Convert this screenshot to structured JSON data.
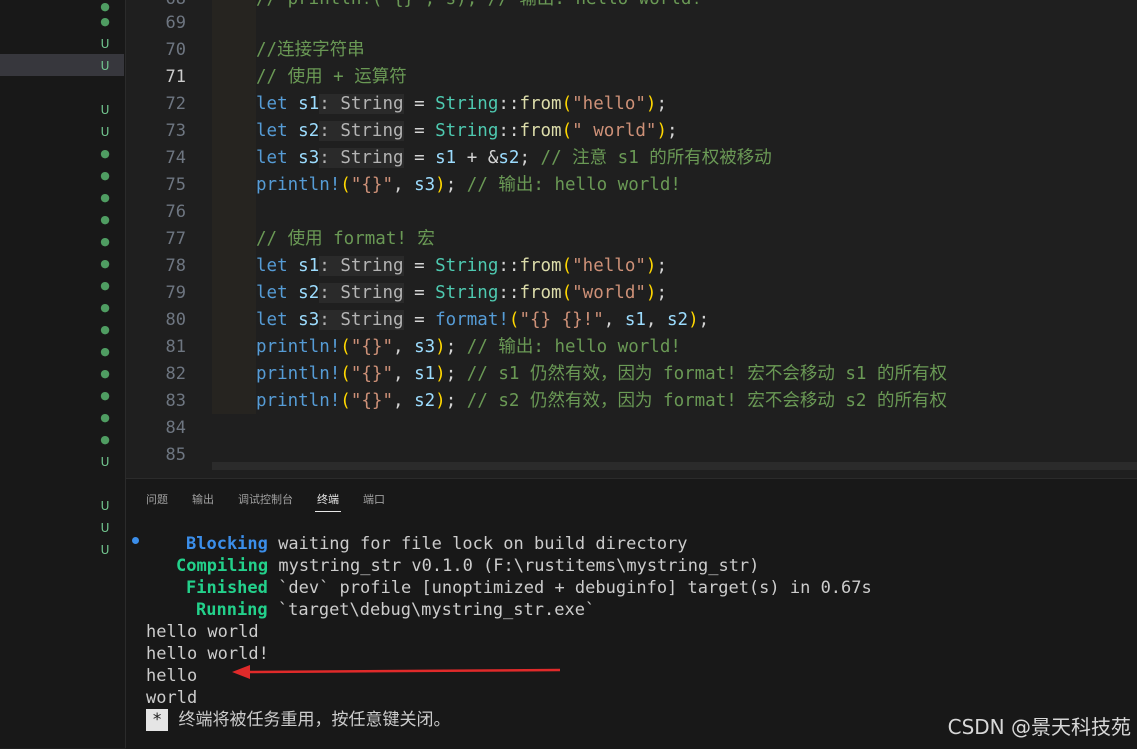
{
  "gutter_marks": [
    "dot",
    "dot",
    "U",
    "U",
    "U",
    "U",
    "dot",
    "dot",
    "dot",
    "dot",
    "dot",
    "dot",
    "dot",
    "dot",
    "dot",
    "dot",
    "dot",
    "dot",
    "dot",
    "dot",
    "U",
    "U",
    "U",
    "U"
  ],
  "editor": {
    "partial_top_line": "// println!(\"{}\", s); // 输出: hello world!",
    "line_numbers": [
      "69",
      "70",
      "71",
      "72",
      "73",
      "74",
      "75",
      "76",
      "77",
      "78",
      "79",
      "80",
      "81",
      "82",
      "83",
      "84",
      "85"
    ],
    "active_line": "71",
    "hint_type": "String",
    "comments": {
      "c70": "//连接字符串",
      "c71": "// 使用 + 运算符",
      "c74": "// 注意 s1 的所有权被移动",
      "c75": "// 输出: hello world!",
      "c77": "// 使用 format! 宏",
      "c81": "// 输出: hello world!",
      "c82": "// s1 仍然有效，因为 format! 宏不会移动 s1 的所有权",
      "c83": "// s2 仍然有效，因为 format! 宏不会移动 s2 的所有权"
    },
    "strings": {
      "hello": "\"hello\"",
      "space_world": "\" world\"",
      "world": "\"world\"",
      "braces": "\"{}\"",
      "fmt": "\"{} {}!\""
    }
  },
  "panel": {
    "tabs": [
      "问题",
      "输出",
      "调试控制台",
      "终端",
      "端口"
    ],
    "active_tab": "终端"
  },
  "terminal": {
    "lines": [
      {
        "label": "Blocking",
        "text": " waiting for file lock on build directory",
        "color": "blue"
      },
      {
        "label": "Compiling",
        "text": " mystring_str v0.1.0 (F:\\rustitems\\mystring_str)",
        "color": "green"
      },
      {
        "label": "Finished",
        "text": " `dev` profile [unoptimized + debuginfo] target(s) in 0.67s",
        "color": "green"
      },
      {
        "label": "Running",
        "text": " `target\\debug\\mystring_str.exe`",
        "color": "green"
      }
    ],
    "output": [
      "hello world",
      "hello world!",
      "hello",
      "world"
    ],
    "cursor_char": "*",
    "exit_message": "终端将被任务重用，按任意键关闭。"
  },
  "watermark": "CSDN @景天科技苑",
  "colors": {
    "arrow": "#e02a2a",
    "keyword": "#569cd6",
    "type": "#4ec9b0",
    "string": "#ce9178",
    "comment": "#6a9955",
    "terminal_blue": "#3b8eea",
    "terminal_green": "#23d18b"
  },
  "icons": {
    "terminal_status": "blue-dot-icon",
    "annotation": "red-arrow-icon"
  }
}
